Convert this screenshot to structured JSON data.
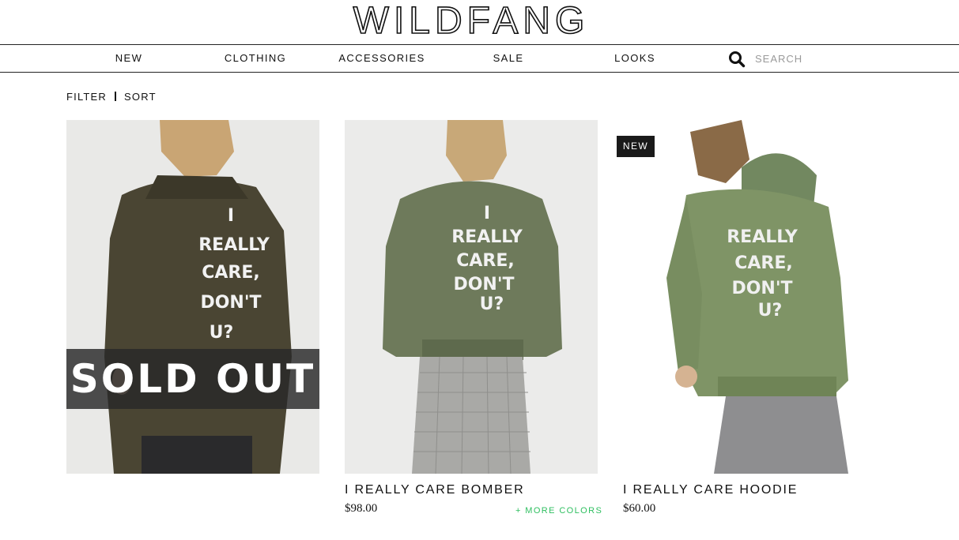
{
  "brand": {
    "logo_text": "WILDFANG"
  },
  "nav": {
    "items": [
      {
        "label": "NEW"
      },
      {
        "label": "CLOTHING"
      },
      {
        "label": "ACCESSORIES"
      },
      {
        "label": "SALE"
      },
      {
        "label": "LOOKS"
      }
    ],
    "search": {
      "placeholder": "SEARCH",
      "icon": "search-icon"
    }
  },
  "filter_bar": {
    "filter_label": "FILTER",
    "sort_label": "SORT"
  },
  "products": [
    {
      "print_text": "I REALLY CARE, DON'T U?",
      "overlay": "SOLD OUT",
      "garment_color": "#4a4533"
    },
    {
      "name": "I REALLY CARE BOMBER",
      "price": "$98.00",
      "more_colors": "+ MORE COLORS",
      "print_text": "I REALLY CARE, DON'T U?",
      "garment_color": "#6e7a5b"
    },
    {
      "name": "I REALLY CARE HOODIE",
      "price": "$60.00",
      "badge": "NEW",
      "print_text": "REALLY CARE, DON'T U?",
      "garment_color": "#7f9466"
    }
  ],
  "colors": {
    "accent": "#2fbf60",
    "text": "#111111",
    "badge_bg": "#1a1a1a"
  }
}
